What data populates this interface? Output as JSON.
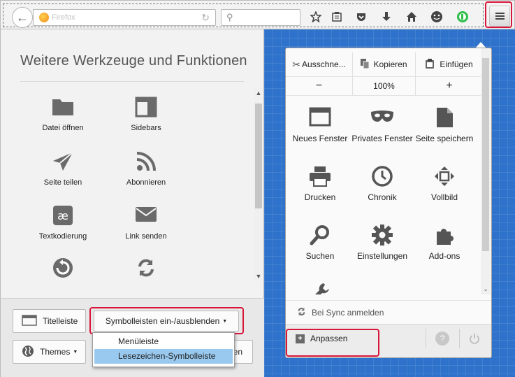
{
  "toolbar": {
    "url_placeholder": "Firefox",
    "icons": [
      "back-icon",
      "reload-icon",
      "search-icon",
      "bookmark-star-icon",
      "reading-list-icon",
      "pocket-icon",
      "download-icon",
      "home-icon",
      "emoji-icon",
      "extension-icon",
      "hamburger-menu-icon"
    ]
  },
  "palette": {
    "title": "Weitere Werkzeuge und Funktionen",
    "items": [
      {
        "label": "Datei öffnen",
        "icon": "folder-icon"
      },
      {
        "label": "Sidebars",
        "icon": "sidebar-icon"
      },
      {
        "label": "Seite teilen",
        "icon": "share-icon"
      },
      {
        "label": "Abonnieren",
        "icon": "rss-icon"
      },
      {
        "label": "Textkodierung",
        "icon": "text-encoding-icon"
      },
      {
        "label": "Link senden",
        "icon": "email-icon"
      },
      {
        "label": "",
        "icon": "history-back-icon"
      },
      {
        "label": "",
        "icon": "sync-icon"
      }
    ]
  },
  "bottom": {
    "titlebar_label": "Titelleiste",
    "toolbars_label": "Symbolleisten ein-/ausblenden",
    "themes_label": "Themes",
    "restore_label_partial": "en"
  },
  "toolbars_dropdown": {
    "options": [
      "Menüleiste",
      "Lesezeichen-Symbolleiste"
    ],
    "selected_index": 1
  },
  "menu_panel": {
    "edit": {
      "cut": "Ausschne...",
      "copy": "Kopieren",
      "paste": "Einfügen"
    },
    "zoom": {
      "minus": "−",
      "level": "100%",
      "plus": "+"
    },
    "items": [
      {
        "label": "Neues Fenster",
        "icon": "new-window-icon"
      },
      {
        "label": "Privates Fenster",
        "icon": "private-mask-icon"
      },
      {
        "label": "Seite speichern",
        "icon": "save-page-icon"
      },
      {
        "label": "Drucken",
        "icon": "print-icon"
      },
      {
        "label": "Chronik",
        "icon": "history-clock-icon"
      },
      {
        "label": "Vollbild",
        "icon": "fullscreen-icon"
      },
      {
        "label": "Suchen",
        "icon": "find-icon"
      },
      {
        "label": "Einstellungen",
        "icon": "settings-gear-icon"
      },
      {
        "label": "Add-ons",
        "icon": "addons-puzzle-icon"
      },
      {
        "label": "",
        "icon": "developer-wrench-icon"
      }
    ],
    "sync_label": "Bei Sync anmelden",
    "customize_label": "Anpassen"
  },
  "colors": {
    "highlight": "#d8163a",
    "background_blue": "#2f72cb",
    "dropdown_selected": "#99c9ef"
  }
}
